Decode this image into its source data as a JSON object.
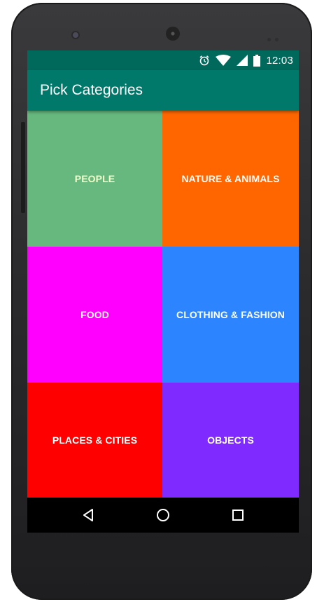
{
  "status_bar": {
    "time": "12:03",
    "icons": [
      "alarm-icon",
      "wifi-icon",
      "cell-signal-icon",
      "battery-icon"
    ]
  },
  "app_bar": {
    "title": "Pick Categories",
    "color": "#00796b",
    "status_color": "#00695c"
  },
  "categories": [
    {
      "label": "PEOPLE",
      "color": "#67b87e"
    },
    {
      "label": "NATURE & ANIMALS",
      "color": "#ff6600"
    },
    {
      "label": "FOOD",
      "color": "#ff00ff"
    },
    {
      "label": "CLOTHING & FASHION",
      "color": "#2d84ff"
    },
    {
      "label": "PLACES & CITIES",
      "color": "#ff0000"
    },
    {
      "label": "OBJECTS",
      "color": "#7f2bff"
    }
  ],
  "nav_bar": {
    "icons": [
      "back-icon",
      "home-icon",
      "recent-apps-icon"
    ]
  }
}
